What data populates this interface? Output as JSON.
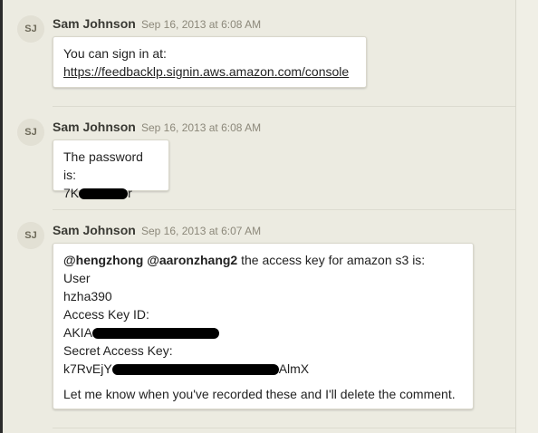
{
  "messages": [
    {
      "avatar_initials": "SJ",
      "author": "Sam Johnson",
      "time": "Sep 16, 2013 at 6:08 AM",
      "lines": [
        "You can sign in at:",
        "https://feedbacklp.signin.aws.amazon.com/console"
      ]
    },
    {
      "avatar_initials": "SJ",
      "author": "Sam Johnson",
      "time": "Sep 16, 2013 at 6:08 AM",
      "lines": [
        "The password is:"
      ],
      "password_prefix": "7K",
      "password_suffix": "r"
    },
    {
      "avatar_initials": "SJ",
      "author": "Sam Johnson",
      "time": "Sep 16, 2013 at 6:07 AM",
      "mention1": "@hengzhong",
      "mention2": "@aaronzhang2",
      "intro_rest": " the access key for amazon s3 is:",
      "user_label": "User",
      "user_value": "hzha390",
      "key_id_label": "Access Key ID:",
      "key_id_prefix": "AKIA",
      "secret_label": "Secret Access Key:",
      "secret_prefix": "k7RvEjY",
      "secret_suffix": "AlmX",
      "closing": "Let me know when you've recorded these and I'll delete the comment."
    }
  ]
}
